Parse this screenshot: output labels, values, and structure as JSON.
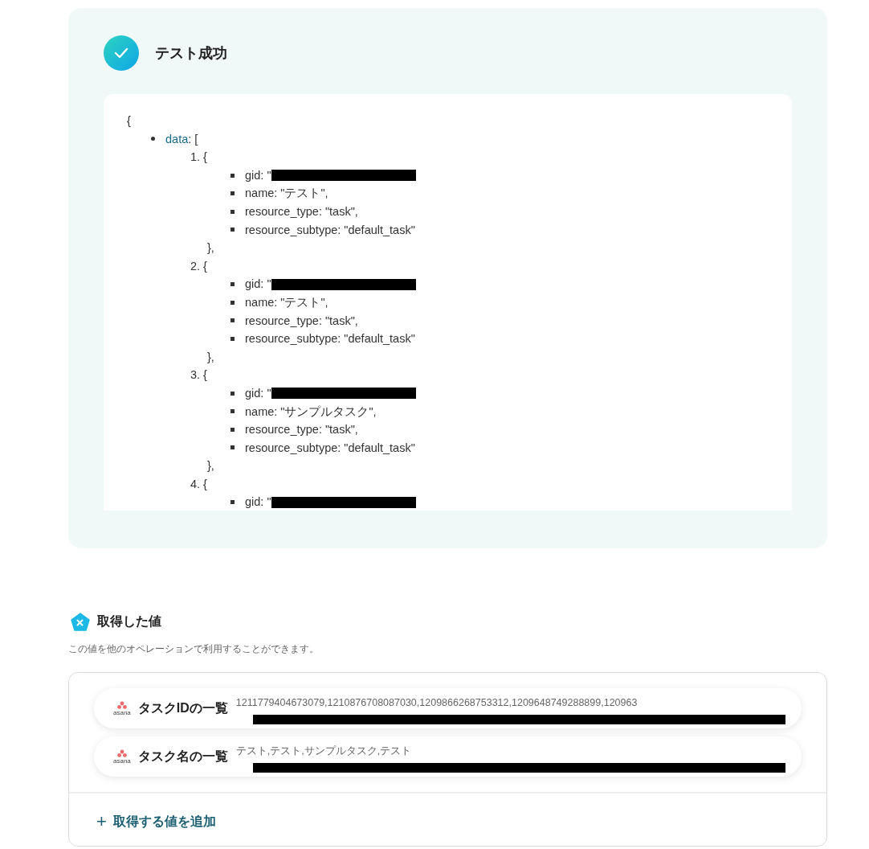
{
  "test_result": {
    "title": "テスト成功",
    "response": {
      "open": "{",
      "entries": [
        {
          "key": "data",
          "text": ": [",
          "items": [
            {
              "marker": "1.",
              "open": "{",
              "fields": [
                {
                  "text": "gid: \"",
                  "redacted": true
                },
                {
                  "text": "name: \"テスト\",",
                  "redacted": false
                },
                {
                  "text": "resource_type: \"task\",",
                  "redacted": false
                },
                {
                  "text": "resource_subtype: \"default_task\"",
                  "redacted": false
                }
              ],
              "close": "},"
            },
            {
              "marker": "2.",
              "open": "{",
              "fields": [
                {
                  "text": "gid: \"",
                  "redacted": true
                },
                {
                  "text": "name: \"テスト\",",
                  "redacted": false
                },
                {
                  "text": "resource_type: \"task\",",
                  "redacted": false
                },
                {
                  "text": "resource_subtype: \"default_task\"",
                  "redacted": false
                }
              ],
              "close": "},"
            },
            {
              "marker": "3.",
              "open": "{",
              "fields": [
                {
                  "text": "gid: \"",
                  "redacted": true
                },
                {
                  "text": "name: \"サンプルタスク\",",
                  "redacted": false
                },
                {
                  "text": "resource_type: \"task\",",
                  "redacted": false
                },
                {
                  "text": "resource_subtype: \"default_task\"",
                  "redacted": false
                }
              ],
              "close": "},"
            },
            {
              "marker": "4.",
              "open": "{",
              "fields": [
                {
                  "text": "gid: \"",
                  "redacted": true
                }
              ]
            }
          ]
        }
      ]
    }
  },
  "obtained_values": {
    "title": "取得した値",
    "description": "この値を他のオペレーションで利用することができます。",
    "values": [
      {
        "brand": "asana",
        "label": "タスクIDの一覧",
        "value": "1211779404673079,1210876708087030,1209866268753312,1209648749288899,120963",
        "redacted": true
      },
      {
        "brand": "asana",
        "label": "タスク名の一覧",
        "value": "テスト,テスト,サンプルタスク,テスト",
        "redacted": true
      }
    ],
    "add_button": {
      "icon": "+",
      "label": "取得する値を追加"
    }
  }
}
